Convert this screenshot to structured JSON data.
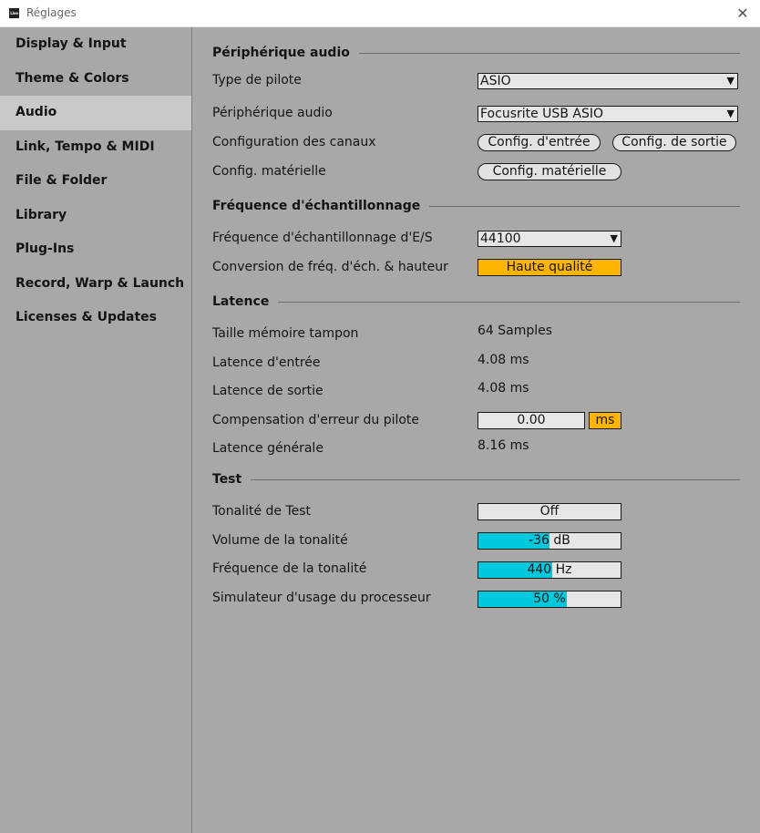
{
  "window": {
    "title": "Réglages",
    "app_icon_text": "Live"
  },
  "sidebar": {
    "items": [
      {
        "label": "Display & Input"
      },
      {
        "label": "Theme & Colors"
      },
      {
        "label": "Audio",
        "selected": true
      },
      {
        "label": "Link, Tempo & MIDI"
      },
      {
        "label": "File & Folder"
      },
      {
        "label": "Library"
      },
      {
        "label": "Plug-Ins"
      },
      {
        "label": "Record, Warp & Launch"
      },
      {
        "label": "Licenses & Updates"
      }
    ]
  },
  "audio_device": {
    "title": "Périphérique audio",
    "driver_type_label": "Type de pilote",
    "driver_type_value": "ASIO",
    "device_label": "Périphérique audio",
    "device_value": "Focusrite USB ASIO",
    "channel_config_label": "Configuration des canaux",
    "input_config_button": "Config. d'entrée",
    "output_config_button": "Config. de sortie",
    "hardware_config_label": "Config. matérielle",
    "hardware_config_button": "Config. matérielle"
  },
  "sample_rate": {
    "title": "Fréquence d'échantillonnage",
    "io_rate_label": "Fréquence d'échantillonnage d'E/S",
    "io_rate_value": "44100",
    "conversion_label": "Conversion de fréq. d'éch. & hauteur",
    "conversion_value": "Haute qualité"
  },
  "latency": {
    "title": "Latence",
    "buffer_label": "Taille mémoire tampon",
    "buffer_value": "64 Samples",
    "input_label": "Latence d'entrée",
    "input_value": "4.08 ms",
    "output_label": "Latence de sortie",
    "output_value": "4.08 ms",
    "driver_comp_label": "Compensation d'erreur du pilote",
    "driver_comp_value": "0.00",
    "driver_comp_unit": "ms",
    "overall_label": "Latence générale",
    "overall_value": "8.16 ms"
  },
  "test": {
    "title": "Test",
    "tone_label": "Tonalité de Test",
    "tone_value": "Off",
    "volume_label": "Volume de la tonalité",
    "volume_value": "-36 dB",
    "volume_fill": 0.5,
    "freq_label": "Fréquence de la tonalité",
    "freq_value": "440 Hz",
    "freq_fill": 0.52,
    "cpu_label": "Simulateur d'usage du processeur",
    "cpu_value": "50 %",
    "cpu_fill": 0.62
  },
  "colors": {
    "background": "#a8a8a8",
    "selected_item": "#c9c9c9",
    "accent_orange": "#ffb400",
    "slider_fill": "#00c8dc"
  },
  "icons": {
    "close": "close-icon",
    "dropdown": "chevron-down-icon"
  }
}
